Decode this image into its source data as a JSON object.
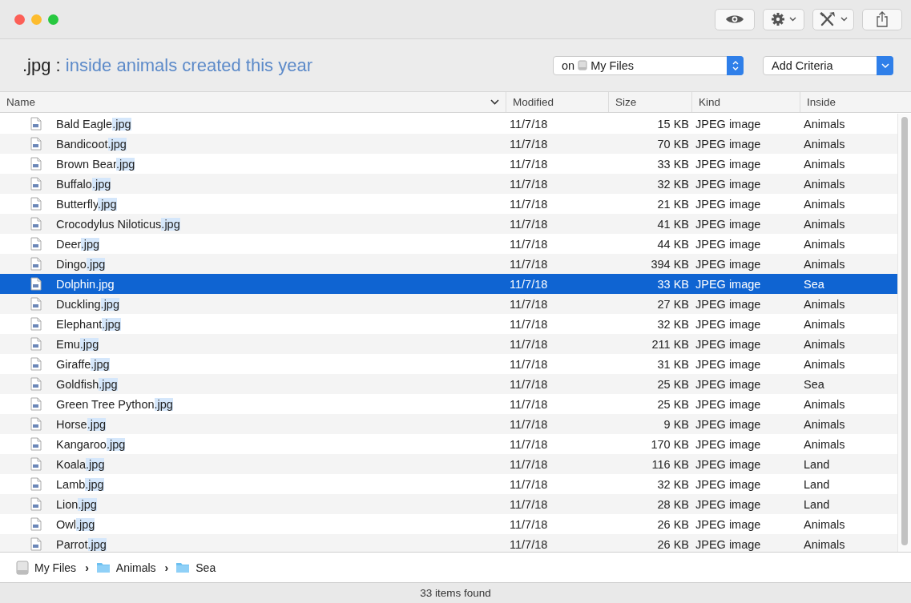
{
  "search": {
    "extension": ".jpg :",
    "query": "inside animals created this year"
  },
  "scope": {
    "prefix": "on",
    "value": "My Files"
  },
  "criteria": {
    "value": "Add Criteria"
  },
  "columns": [
    {
      "label": "Name",
      "sorted": true
    },
    {
      "label": "Modified",
      "sorted": false
    },
    {
      "label": "Size",
      "sorted": false
    },
    {
      "label": "Kind",
      "sorted": false
    },
    {
      "label": "Inside",
      "sorted": false
    }
  ],
  "rows": [
    {
      "name": "Bald Eagle",
      "match": ".jpg",
      "modified": "11/7/18",
      "size": "15 KB",
      "kind": "JPEG image",
      "inside": "Animals",
      "selected": false
    },
    {
      "name": "Bandicoot",
      "match": ".jpg",
      "modified": "11/7/18",
      "size": "70 KB",
      "kind": "JPEG image",
      "inside": "Animals",
      "selected": false
    },
    {
      "name": "Brown Bear",
      "match": ".jpg",
      "modified": "11/7/18",
      "size": "33 KB",
      "kind": "JPEG image",
      "inside": "Animals",
      "selected": false
    },
    {
      "name": "Buffalo",
      "match": ".jpg",
      "modified": "11/7/18",
      "size": "32 KB",
      "kind": "JPEG image",
      "inside": "Animals",
      "selected": false
    },
    {
      "name": "Butterfly",
      "match": ".jpg",
      "modified": "11/7/18",
      "size": "21 KB",
      "kind": "JPEG image",
      "inside": "Animals",
      "selected": false
    },
    {
      "name": "Crocodylus Niloticus",
      "match": ".jpg",
      "modified": "11/7/18",
      "size": "41 KB",
      "kind": "JPEG image",
      "inside": "Animals",
      "selected": false
    },
    {
      "name": "Deer",
      "match": ".jpg",
      "modified": "11/7/18",
      "size": "44 KB",
      "kind": "JPEG image",
      "inside": "Animals",
      "selected": false
    },
    {
      "name": "Dingo",
      "match": ".jpg",
      "modified": "11/7/18",
      "size": "394 KB",
      "kind": "JPEG image",
      "inside": "Animals",
      "selected": false
    },
    {
      "name": "Dolphin",
      "match": ".jpg",
      "modified": "11/7/18",
      "size": "33 KB",
      "kind": "JPEG image",
      "inside": "Sea",
      "selected": true
    },
    {
      "name": "Duckling",
      "match": ".jpg",
      "modified": "11/7/18",
      "size": "27 KB",
      "kind": "JPEG image",
      "inside": "Animals",
      "selected": false
    },
    {
      "name": "Elephant",
      "match": ".jpg",
      "modified": "11/7/18",
      "size": "32 KB",
      "kind": "JPEG image",
      "inside": "Animals",
      "selected": false
    },
    {
      "name": "Emu",
      "match": ".jpg",
      "modified": "11/7/18",
      "size": "211 KB",
      "kind": "JPEG image",
      "inside": "Animals",
      "selected": false
    },
    {
      "name": "Giraffe",
      "match": ".jpg",
      "modified": "11/7/18",
      "size": "31 KB",
      "kind": "JPEG image",
      "inside": "Animals",
      "selected": false
    },
    {
      "name": "Goldfish",
      "match": ".jpg",
      "modified": "11/7/18",
      "size": "25 KB",
      "kind": "JPEG image",
      "inside": "Sea",
      "selected": false
    },
    {
      "name": "Green Tree Python",
      "match": ".jpg",
      "modified": "11/7/18",
      "size": "25 KB",
      "kind": "JPEG image",
      "inside": "Animals",
      "selected": false
    },
    {
      "name": "Horse",
      "match": ".jpg",
      "modified": "11/7/18",
      "size": "9 KB",
      "kind": "JPEG image",
      "inside": "Animals",
      "selected": false
    },
    {
      "name": "Kangaroo",
      "match": ".jpg",
      "modified": "11/7/18",
      "size": "170 KB",
      "kind": "JPEG image",
      "inside": "Animals",
      "selected": false
    },
    {
      "name": "Koala",
      "match": ".jpg",
      "modified": "11/7/18",
      "size": "116 KB",
      "kind": "JPEG image",
      "inside": "Land",
      "selected": false
    },
    {
      "name": "Lamb",
      "match": ".jpg",
      "modified": "11/7/18",
      "size": "32 KB",
      "kind": "JPEG image",
      "inside": "Land",
      "selected": false
    },
    {
      "name": "Lion",
      "match": ".jpg",
      "modified": "11/7/18",
      "size": "28 KB",
      "kind": "JPEG image",
      "inside": "Land",
      "selected": false
    },
    {
      "name": "Owl",
      "match": ".jpg",
      "modified": "11/7/18",
      "size": "26 KB",
      "kind": "JPEG image",
      "inside": "Animals",
      "selected": false
    },
    {
      "name": "Parrot",
      "match": ".jpg",
      "modified": "11/7/18",
      "size": "26 KB",
      "kind": "JPEG image",
      "inside": "Animals",
      "selected": false
    }
  ],
  "path": [
    {
      "label": "My Files",
      "kind": "drive"
    },
    {
      "label": "Animals",
      "kind": "folder"
    },
    {
      "label": "Sea",
      "kind": "folder"
    }
  ],
  "path_separator": "›",
  "status_bar": "33 items found"
}
